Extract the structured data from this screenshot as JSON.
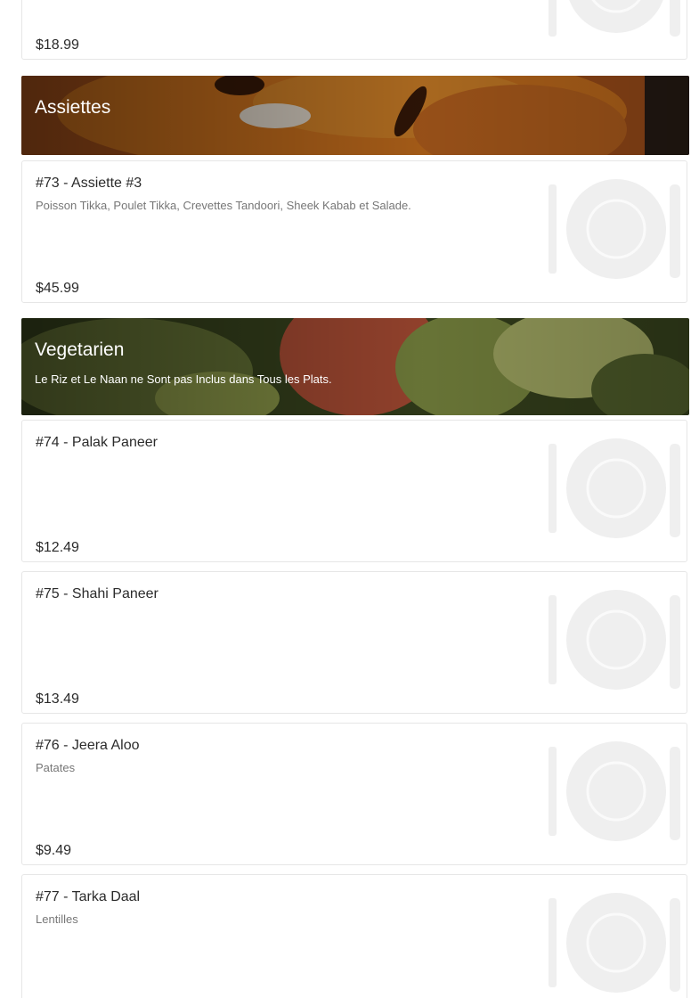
{
  "items": [
    {
      "price": "$18.99"
    },
    {
      "name": "#73 - Assiette #3",
      "desc": "Poisson Tikka, Poulet Tikka, Crevettes Tandoori, Sheek Kabab et Salade.",
      "price": "$45.99"
    },
    {
      "name": "#74 - Palak Paneer",
      "desc": "",
      "price": "$12.49"
    },
    {
      "name": "#75 - Shahi Paneer",
      "desc": "",
      "price": "$13.49"
    },
    {
      "name": "#76 - Jeera Aloo",
      "desc": "Patates",
      "price": "$9.49"
    },
    {
      "name": "#77 - Tarka Daal",
      "desc": "Lentilles",
      "price": ""
    }
  ],
  "sections": [
    {
      "title": "Assiettes",
      "subtitle": ""
    },
    {
      "title": "Vegetarien",
      "subtitle": "Le Riz et Le Naan ne Sont pas Inclus dans Tous les Plats."
    }
  ],
  "icons": {
    "placeholder": "plate-cutlery-icon"
  }
}
